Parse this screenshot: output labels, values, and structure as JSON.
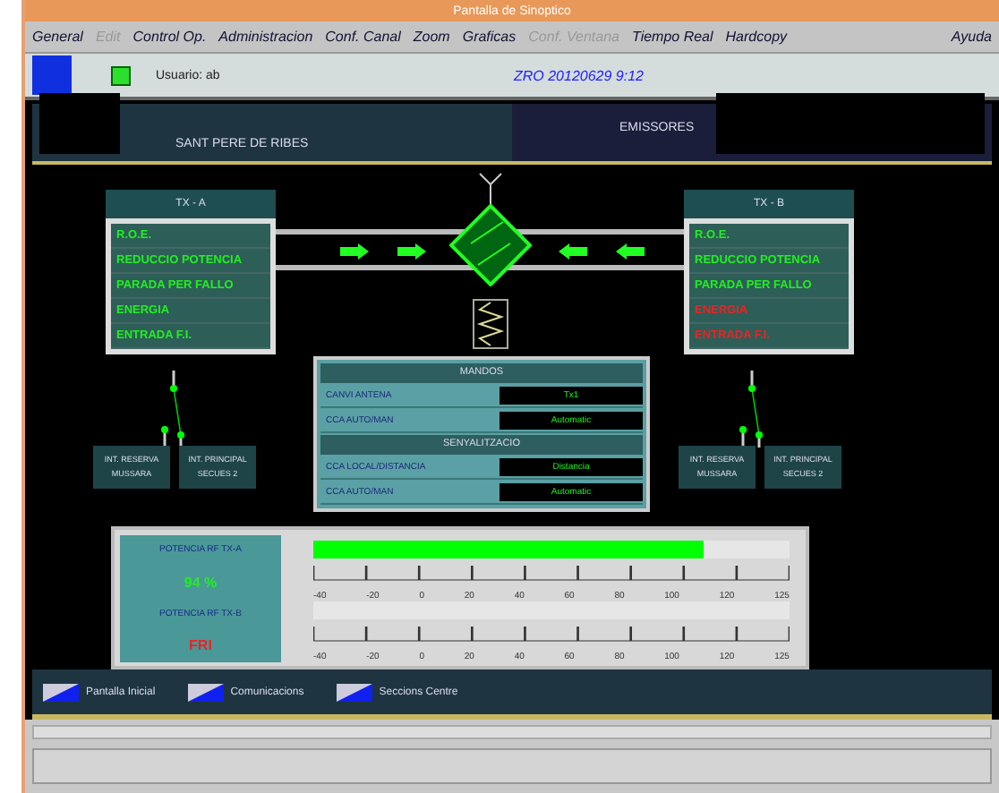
{
  "window": {
    "title": "Pantalla de Sinoptico"
  },
  "menu": [
    {
      "label": "General",
      "disabled": false
    },
    {
      "label": "Edit",
      "disabled": true
    },
    {
      "label": "Control Op.",
      "disabled": false
    },
    {
      "label": "Administracion",
      "disabled": false
    },
    {
      "label": "Conf. Canal",
      "disabled": false
    },
    {
      "label": "Zoom",
      "disabled": false
    },
    {
      "label": "Graficas",
      "disabled": false
    },
    {
      "label": "Conf. Ventana",
      "disabled": true
    },
    {
      "label": "Tiempo Real",
      "disabled": false
    },
    {
      "label": "Hardcopy",
      "disabled": false
    },
    {
      "label": "Ayuda",
      "disabled": false
    }
  ],
  "info_bar": {
    "user": "Usuario: ab",
    "timestamp": "ZRO 20120629 9:12"
  },
  "header": {
    "site": "SANT PERE DE RIBES",
    "section": "EMISSORES"
  },
  "transmitters": [
    {
      "title": "TX - A",
      "states": [
        {
          "label": "R.O.E.",
          "alarm": false
        },
        {
          "label": "REDUCCIO POTENCIA",
          "alarm": false
        },
        {
          "label": "PARADA PER FALLO",
          "alarm": false
        },
        {
          "label": "ENERGIA",
          "alarm": false
        },
        {
          "label": "ENTRADA F.I.",
          "alarm": false
        }
      ],
      "switches": [
        {
          "line1": "INT. RESERVA",
          "line2": "MUSSARA"
        },
        {
          "line1": "INT. PRINCIPAL",
          "line2": "SECUES 2"
        }
      ]
    },
    {
      "title": "TX - B",
      "states": [
        {
          "label": "R.O.E.",
          "alarm": false
        },
        {
          "label": "REDUCCIO POTENCIA",
          "alarm": false
        },
        {
          "label": "PARADA PER FALLO",
          "alarm": false
        },
        {
          "label": "ENERGIA",
          "alarm": true
        },
        {
          "label": "ENTRADA F.I.",
          "alarm": true
        }
      ],
      "switches": [
        {
          "line1": "INT. RESERVA",
          "line2": "MUSSARA"
        },
        {
          "line1": "INT. PRINCIPAL",
          "line2": "SECUES 2"
        }
      ]
    }
  ],
  "controls": [
    {
      "title": "MANDOS",
      "rows": [
        {
          "label": "CANVI ANTENA",
          "value": "Tx1"
        },
        {
          "label": "CCA AUTO/MAN",
          "value": "Automatic"
        }
      ]
    },
    {
      "title": "SENYALITZACIO",
      "rows": [
        {
          "label": "CCA LOCAL/DISTANCIA",
          "value": "Distancia"
        },
        {
          "label": "CCA AUTO/MAN",
          "value": "Automatic"
        }
      ]
    }
  ],
  "power": [
    {
      "label": "POTENCIA RF TX-A",
      "reading": "94 %",
      "alarm": false,
      "level": 0.82,
      "ticks": [
        "-40",
        "-20",
        "0",
        "20",
        "40",
        "60",
        "80",
        "100",
        "120",
        "125"
      ]
    },
    {
      "label": "POTENCIA RF TX-B",
      "reading": "FRI",
      "alarm": true,
      "ticks": [
        "-40",
        "-20",
        "0",
        "20",
        "40",
        "60",
        "80",
        "100",
        "120",
        "125"
      ]
    }
  ],
  "nav": [
    "Pantalla Inicial",
    "Comunicacions",
    "Seccions Centre"
  ]
}
